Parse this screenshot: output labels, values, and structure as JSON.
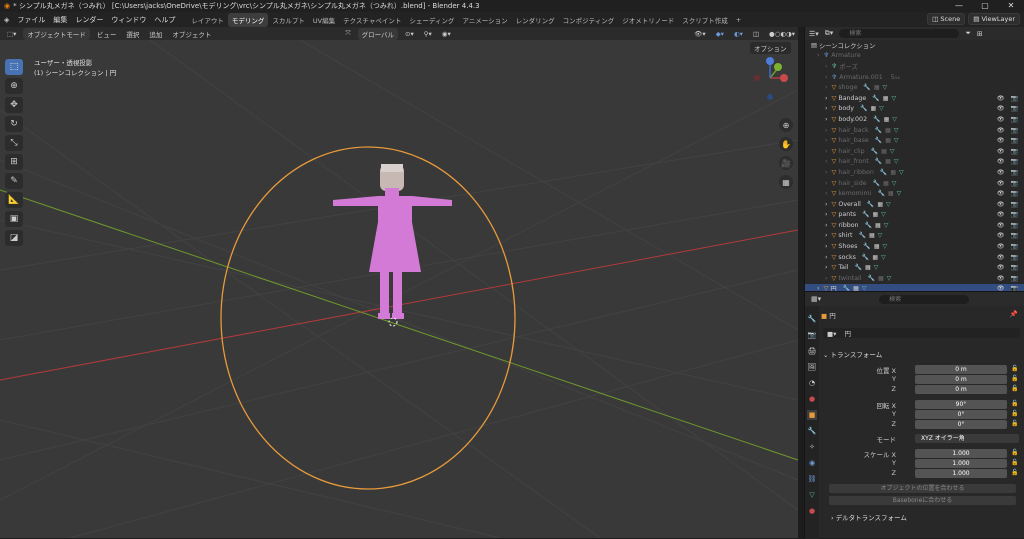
{
  "window": {
    "title": "* シンプル丸メガネ（つみれ） [C:\\Users\\jacks\\OneDrive\\モデリング\\vrc\\シンプル丸メガネ\\シンプル丸メガネ（つみれ）.blend] - Blender 4.4.3",
    "controls": [
      "—",
      "▢",
      "✕"
    ]
  },
  "menubar": {
    "menus": [
      "ファイル",
      "編集",
      "レンダー",
      "ウィンドウ",
      "ヘルプ"
    ],
    "workspaces": [
      "レイアウト",
      "モデリング",
      "スカルプト",
      "UV編集",
      "テクスチャペイント",
      "シェーディング",
      "アニメーション",
      "レンダリング",
      "コンポジティング",
      "ジオメトリノード",
      "スクリプト作成"
    ],
    "active_workspace": "モデリング",
    "add_tab": "+",
    "scene": "Scene",
    "view_layer": "ViewLayer"
  },
  "viewport_header": {
    "mode": "オブジェクトモード",
    "menus": [
      "ビュー",
      "選択",
      "追加",
      "オブジェクト"
    ],
    "orientation": "グローバル",
    "options": "オプション"
  },
  "viewport": {
    "view_name": "ユーザー・透視投影",
    "collection_line": "(1) シーンコレクション | 円",
    "gizmo_labels": [
      "X",
      "Y",
      "Z"
    ]
  },
  "toolbar_icons": [
    "select-box-icon",
    "cursor-icon",
    "move-icon",
    "rotate-icon",
    "scale-icon",
    "transform-icon",
    "annotate-icon",
    "measure-icon",
    "add-cube-icon",
    "add-primitive-icon"
  ],
  "outliner": {
    "search_placeholder": "検索",
    "root": "シーンコレクション",
    "rows": [
      {
        "name": "Armature",
        "type": "armature",
        "dim": true,
        "indent": 0
      },
      {
        "name": "ポーズ",
        "type": "pose",
        "dim": true,
        "indent": 1
      },
      {
        "name": "Armature.001",
        "type": "armature",
        "dim": true,
        "indent": 1,
        "badge": "5₁₄"
      },
      {
        "name": "shoge",
        "type": "mesh",
        "dim": true,
        "indent": 1
      },
      {
        "name": "Bandage",
        "type": "mesh",
        "dim": false,
        "indent": 1
      },
      {
        "name": "body",
        "type": "mesh",
        "dim": false,
        "indent": 1
      },
      {
        "name": "body.002",
        "type": "mesh",
        "dim": false,
        "indent": 1
      },
      {
        "name": "hair_back",
        "type": "mesh",
        "dim": true,
        "indent": 1
      },
      {
        "name": "hair_base",
        "type": "mesh",
        "dim": true,
        "indent": 1
      },
      {
        "name": "hair_clip",
        "type": "mesh",
        "dim": true,
        "indent": 1
      },
      {
        "name": "hair_front",
        "type": "mesh",
        "dim": true,
        "indent": 1
      },
      {
        "name": "hair_ribbon",
        "type": "mesh",
        "dim": true,
        "indent": 1
      },
      {
        "name": "hair_side",
        "type": "mesh",
        "dim": true,
        "indent": 1
      },
      {
        "name": "kemomimi",
        "type": "mesh",
        "dim": true,
        "indent": 1
      },
      {
        "name": "Overall",
        "type": "mesh",
        "dim": false,
        "indent": 1
      },
      {
        "name": "pants",
        "type": "mesh",
        "dim": false,
        "indent": 1
      },
      {
        "name": "ribbon",
        "type": "mesh",
        "dim": false,
        "indent": 1
      },
      {
        "name": "shirt",
        "type": "mesh",
        "dim": false,
        "indent": 1
      },
      {
        "name": "Shoes",
        "type": "mesh",
        "dim": false,
        "indent": 1
      },
      {
        "name": "socks",
        "type": "mesh",
        "dim": false,
        "indent": 1
      },
      {
        "name": "Tail",
        "type": "mesh",
        "dim": false,
        "indent": 1
      },
      {
        "name": "twintail",
        "type": "mesh",
        "dim": true,
        "indent": 1
      },
      {
        "name": "円",
        "type": "mesh",
        "dim": false,
        "indent": 0,
        "selected": true
      }
    ]
  },
  "properties": {
    "search_placeholder": "検索",
    "object_name": "円",
    "object_field": "円",
    "transform_header": "トランスフォーム",
    "location_label": "位置 X",
    "location": [
      "0 m",
      "0 m",
      "0 m"
    ],
    "rotation_label": "回転 X",
    "rotation": [
      "90°",
      "0°",
      "0°"
    ],
    "axis_labels": [
      "Y",
      "Z"
    ],
    "mode_label": "モード",
    "mode_value": "XYZ オイラー角",
    "scale_label": "スケール X",
    "scale": [
      "1.000",
      "1.000",
      "1.000"
    ],
    "btn_match_pos": "オブジェクトの位置を合わせる",
    "btn_baseoffset": "Baseboneに合わせる",
    "delta_header": "デルタトランスフォーム"
  },
  "colors": {
    "accent": "#4772b3",
    "selection_circle": "#e69a3a",
    "model": "#d27ad6",
    "axis_x": "#b23b3b",
    "axis_y": "#6f9a2b"
  }
}
